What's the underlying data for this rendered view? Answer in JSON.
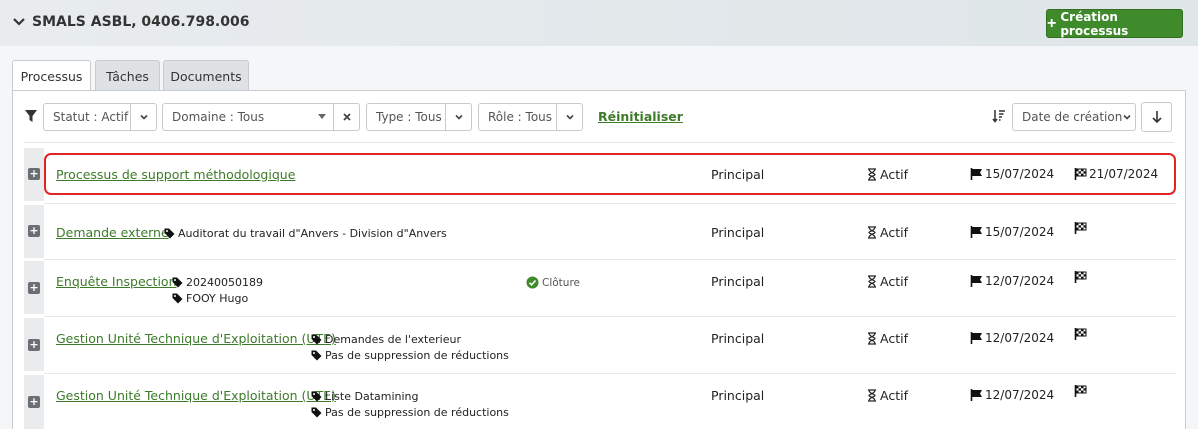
{
  "header": {
    "title": "SMALS ASBL, 0406.798.006",
    "create_button": "Création processus"
  },
  "tabs": [
    {
      "label": "Processus",
      "active": true
    },
    {
      "label": "Tâches",
      "active": false
    },
    {
      "label": "Documents",
      "active": false
    }
  ],
  "filters": {
    "statut": "Statut : Actif",
    "domaine": "Domaine : Tous",
    "type": "Type : Tous",
    "role": "Rôle : Tous",
    "reset": "Réinitialiser",
    "sort": "Date de création"
  },
  "rows": [
    {
      "name": "Processus de support méthodologique",
      "tags": [],
      "role": "Principal",
      "status": "Actif",
      "start": "15/07/2024",
      "end": "21/07/2024"
    },
    {
      "name": "Demande externe",
      "tags": [
        "Auditorat du travail d\"Anvers - Division d\"Anvers"
      ],
      "role": "Principal",
      "status": "Actif",
      "start": "15/07/2024",
      "end": ""
    },
    {
      "name": "Enquête Inspection",
      "tags": [
        "20240050189",
        "FOOY Hugo"
      ],
      "badge": "Clôture",
      "role": "Principal",
      "status": "Actif",
      "start": "12/07/2024",
      "end": ""
    },
    {
      "name": "Gestion Unité Technique d'Exploitation (UTE)",
      "tags": [
        "Demandes de l'exterieur",
        "Pas de suppression de réductions"
      ],
      "role": "Principal",
      "status": "Actif",
      "start": "12/07/2024",
      "end": ""
    },
    {
      "name": "Gestion Unité Technique d'Exploitation (UTE)",
      "tags": [
        "Liste Datamining",
        "Pas de suppression de réductions"
      ],
      "role": "Principal",
      "status": "Actif",
      "start": "12/07/2024",
      "end": ""
    }
  ],
  "colors": {
    "accent": "#3f8a2a",
    "link": "#3d7a2a",
    "highlight": "#e02424"
  }
}
